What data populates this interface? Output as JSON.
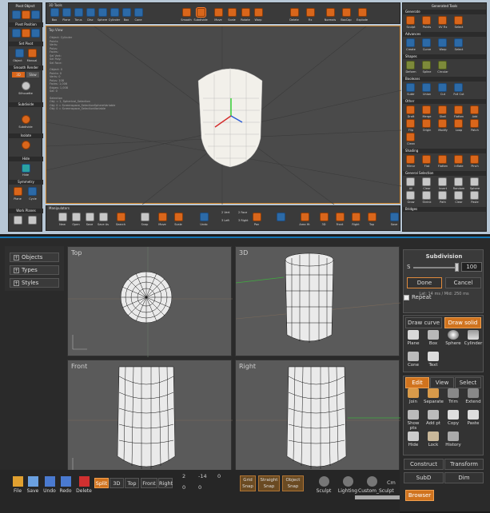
{
  "top": {
    "left_panel": {
      "title": "Pivot Object",
      "pivot_labels": [
        "Rel",
        "Center",
        "Ori"
      ],
      "pivot_position_title": "Pivot Position",
      "pivot_position_labels": [
        "Scene",
        "Cursor",
        "Ori"
      ],
      "set_pivot_title": "Set Pivot",
      "set_pivot_labels": [
        "Object",
        "Manual"
      ],
      "smooth_render_title": "Smooth Render",
      "smooth_render_toggles": [
        "3D",
        "Slow"
      ],
      "silhouette_label": "Silhouette",
      "subdivide_title": "Subdivide",
      "subdivide_levels": [
        "1",
        "2",
        "3",
        "4"
      ],
      "subdivide_label": "Subdivide",
      "isolate_title": "Isolate",
      "hide_title": "Hide",
      "hide_label": "Hide",
      "symmetry_title": "Symmetry",
      "symmetry_labels": [
        "On",
        "Create",
        "Plane",
        "Cycle"
      ],
      "work_planes_title": "Work Planes",
      "work_planes_labels": [
        "Reset",
        "Set"
      ]
    },
    "toolbar": {
      "title": "3D Tools",
      "buttons": [
        "Box",
        "Plane",
        "Torus",
        "Disc",
        "Sphere",
        "Cylinder",
        "Box",
        "Cone",
        "Smooth",
        "Subdivide",
        "Move",
        "Scale",
        "Rotate",
        "Warp",
        "Delete",
        "Fix",
        "Normals",
        "BoxCap",
        "Explode"
      ]
    },
    "viewport": {
      "label": "Top View",
      "info_lines": [
        "Object: Cylinder",
        "Points",
        "Verts:",
        "Polys:",
        "Faces:",
        "Sel Vert:",
        "Sel Poly:",
        "Sel Face:"
      ],
      "info_lines2": [
        "Object: 0",
        "Points: 0",
        "Verts: 0",
        "Polys: 108",
        "Faces: 1,006",
        "Edges: 1,008",
        "Sel: 0"
      ],
      "info_lines3": [
        "Selection",
        "Obj: = 1, Spherical_Selection",
        "Obj: 0 = Screenspace_SelectionSphereVariable",
        "Obj: 0 = Screenspace_SelectionVariable"
      ]
    },
    "bottom_bar": {
      "title": "Manipulators",
      "buttons": [
        "New",
        "Open",
        "Save",
        "Save As",
        "Search",
        "Snap",
        "Move",
        "Scale",
        "Undo",
        "2 Vert",
        "3 Left",
        "2 Face",
        "3 Right",
        "Pan",
        "",
        "Area Ht",
        "3D",
        "Front",
        "Right",
        "Top",
        "Save"
      ]
    },
    "right_panel": {
      "title": "Generated Tools",
      "sections": [
        {
          "name": "Generate",
          "items": [
            "Sculpt",
            "Paints",
            "UV Fix",
            "Select"
          ]
        },
        {
          "name": "Advances",
          "items": [
            "Create",
            "Curve",
            "Warp",
            "Select"
          ]
        },
        {
          "name": "Shapes",
          "items": [
            "Deform",
            "Spline",
            "Circular"
          ]
        },
        {
          "name": "Booleans",
          "items": [
            "Subtr",
            "Union",
            "Cut",
            "Full Cut"
          ]
        },
        {
          "name": "Other",
          "items": [
            "Draft",
            "Merge",
            "Shell",
            "Flatten",
            "Add",
            "Flip",
            "Origin",
            "Modify",
            "Loop",
            "Patch",
            "Clean"
          ]
        },
        {
          "name": "Shading",
          "items": [
            "Mirror",
            "Flat",
            "Flatten",
            "Inflate",
            "Pinch"
          ]
        },
        {
          "name": "General Selection",
          "items": [
            "All",
            "Clear",
            "Invert",
            "Random",
            "Sphere",
            "Grow",
            "Shrink",
            "Path",
            "Clear",
            "Paste"
          ]
        },
        {
          "name": "Bridges",
          "items": []
        }
      ]
    }
  },
  "bottom": {
    "tree": [
      "Objects",
      "Types",
      "Styles"
    ],
    "views": [
      "Top",
      "3D",
      "Front",
      "Right"
    ],
    "subdivision": {
      "title": "Subdivision",
      "slider_label": "S",
      "value": "100",
      "done": "Done",
      "cancel": "Cancel",
      "info": "Lat: 14 ms / Mid: 250 ms",
      "repeat": "Repeat"
    },
    "draw": {
      "tab1": "Draw curve",
      "tab2": "Draw solid",
      "shapes": [
        "Plane",
        "Box",
        "Sphere",
        "Cylinder",
        "Cone",
        "Text"
      ]
    },
    "edit_tabs": [
      "Edit",
      "View",
      "Select"
    ],
    "edit_tools": [
      "Join",
      "Separate",
      "Trim",
      "Extend",
      "Show pts",
      "Add pt",
      "Copy",
      "Paste",
      "Hide",
      "Lock",
      "History"
    ],
    "construct_tabs": [
      "Construct",
      "Transform"
    ],
    "subd_tabs": [
      "SubD",
      "Dim"
    ],
    "browser": "Browser",
    "bottom_tools": {
      "left": [
        "File",
        "Save",
        "Undo",
        "Redo",
        "Delete"
      ],
      "view_mode": [
        "Split",
        "3D",
        "Top",
        "Front",
        "Right"
      ],
      "coords": [
        "2",
        "-14",
        "0",
        "0",
        "0"
      ],
      "snaps": [
        "Grid Snap",
        "Straight Snap",
        "Object Snap"
      ],
      "scene": [
        "Sculpt",
        "Lighting",
        "Custom_Sculpt"
      ],
      "values": [
        "Cm"
      ]
    }
  }
}
